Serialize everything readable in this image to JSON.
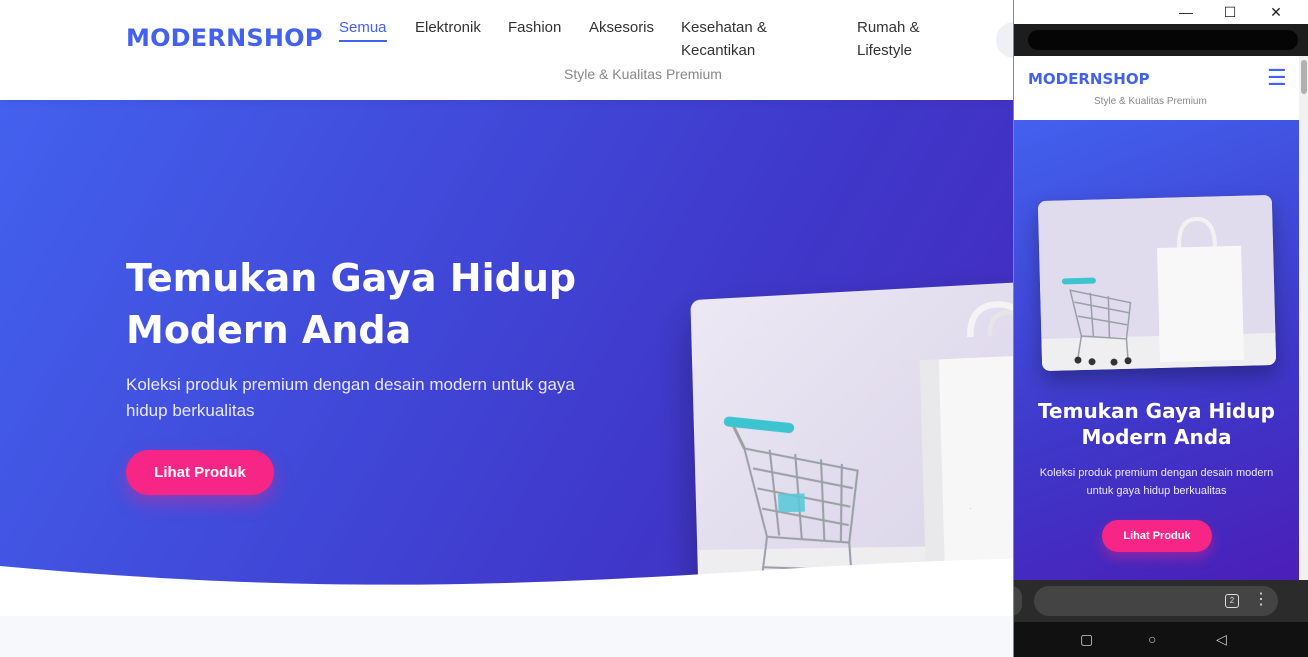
{
  "desktop": {
    "logo": "MODERNSHOP",
    "nav": [
      {
        "label": "Semua",
        "active": true
      },
      {
        "label": "Elektronik"
      },
      {
        "label": "Fashion"
      },
      {
        "label": "Aksesoris"
      },
      {
        "label": "Kesehatan & Kecantikan"
      },
      {
        "label": "Rumah & Lifestyle"
      }
    ],
    "tagline": "Style & Kualitas Premium",
    "hero": {
      "title": "Temukan Gaya Hidup Modern Anda",
      "subtitle": "Koleksi produk premium dengan desain modern untuk gaya hidup berkualitas",
      "cta": "Lihat Produk"
    }
  },
  "mobile": {
    "window_controls": {
      "minimize": "—",
      "maximize": "☐",
      "close": "✕"
    },
    "logo": "MODERNSHOP",
    "menu_icon": "☰",
    "tagline": "Style & Kualitas Premium",
    "hero": {
      "title": "Temukan Gaya Hidup Modern Anda",
      "subtitle": "Koleksi produk premium dengan desain modern untuk gaya hidup berkualitas",
      "cta": "Lihat Produk"
    },
    "browser": {
      "tab_count": "2",
      "more_icon": "⋮"
    },
    "nav_keys": {
      "recents": "▢",
      "home": "○",
      "back": "◁"
    }
  },
  "colors": {
    "brand": "#4361ee",
    "hero_gradient_start": "#4361ee",
    "hero_gradient_end": "#3f37c9",
    "cta": "#f72585"
  },
  "icons": {
    "product_image": "shopping-cart-and-bag-photo",
    "hamburger": "menu-icon",
    "minimize": "minimize-icon",
    "maximize": "maximize-icon",
    "close": "close-icon"
  }
}
